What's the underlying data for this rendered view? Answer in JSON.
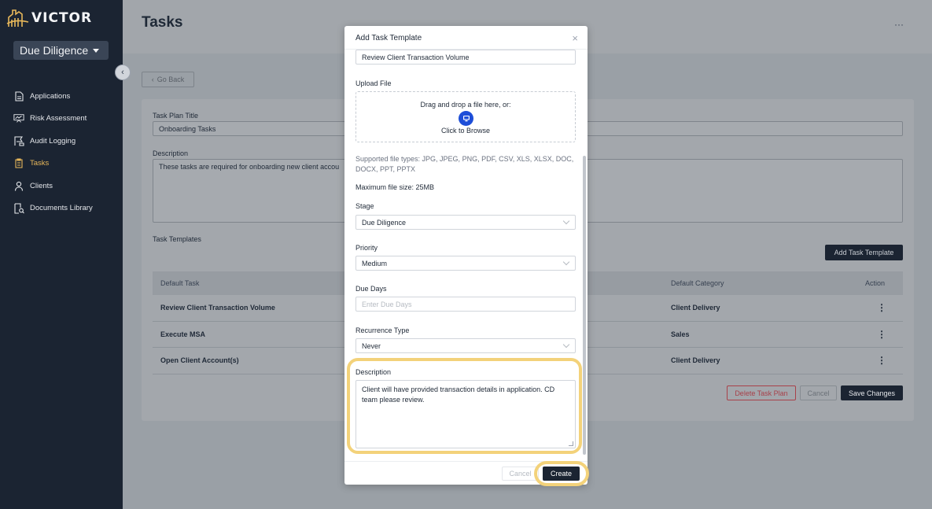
{
  "app": {
    "logo_text": "VICTOR",
    "stage": "Due Diligence"
  },
  "sidebar": {
    "items": [
      {
        "label": "Applications",
        "icon": "document-icon",
        "active": false
      },
      {
        "label": "Risk Assessment",
        "icon": "chart-board-icon",
        "active": false
      },
      {
        "label": "Audit Logging",
        "icon": "flag-icon",
        "active": false
      },
      {
        "label": "Tasks",
        "icon": "clipboard-icon",
        "active": true
      },
      {
        "label": "Clients",
        "icon": "user-icon",
        "active": false
      },
      {
        "label": "Documents Library",
        "icon": "document-search-icon",
        "active": false
      }
    ]
  },
  "page": {
    "title": "Tasks",
    "go_back": "Go Back",
    "task_plan_title_label": "Task Plan Title",
    "task_plan_title_value": "Onboarding Tasks",
    "description_label": "Description",
    "description_value": "These tasks are required for onboarding new client accou",
    "task_templates_label": "Task Templates",
    "add_task_template": "Add Task Template",
    "table": {
      "col_default_task": "Default Task",
      "col_default_category": "Default Category",
      "col_action": "Action",
      "rows": [
        {
          "task": "Review Client Transaction Volume",
          "category": "Client Delivery"
        },
        {
          "task": "Execute MSA",
          "category": "Sales"
        },
        {
          "task": "Open Client Account(s)",
          "category": "Client Delivery"
        }
      ]
    },
    "delete_button": "Delete Task Plan",
    "cancel_button": "Cancel",
    "save_button": "Save Changes"
  },
  "modal": {
    "title": "Add Task Template",
    "task_name_value": "Review Client Transaction Volume",
    "upload_label": "Upload File",
    "dropzone_text": "Drag and drop a file here, or:",
    "dropzone_browse": "Click to Browse",
    "supported_types": "Supported file types: JPG, JPEG, PNG, PDF, CSV, XLS, XLSX, DOC, DOCX, PPT, PPTX",
    "max_size": "Maximum file size: 25MB",
    "stage_label": "Stage",
    "stage_value": "Due Diligence",
    "priority_label": "Priority",
    "priority_value": "Medium",
    "due_days_label": "Due Days",
    "due_days_placeholder": "Enter Due Days",
    "recurrence_label": "Recurrence Type",
    "recurrence_value": "Never",
    "description_label": "Description",
    "description_value": "Client will have provided transaction details in application. CD team please review.",
    "cancel_button": "Cancel",
    "create_button": "Create"
  },
  "colors": {
    "accent": "#e7b75a",
    "dark": "#1b2432",
    "highlight": "#f3d27a",
    "danger": "#a8414a"
  }
}
